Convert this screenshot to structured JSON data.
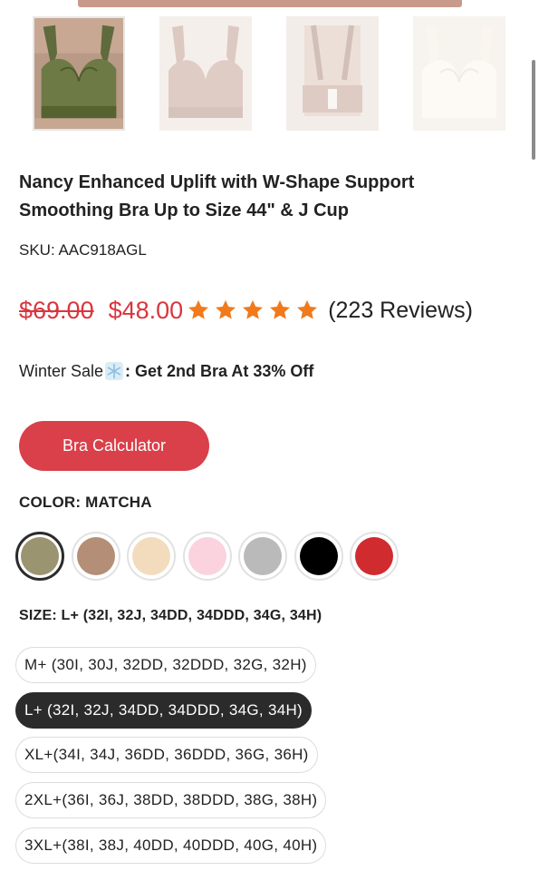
{
  "product": {
    "title_line1": "Nancy Enhanced Uplift with W-Shape Support",
    "title_line2": "Smoothing Bra Up to Size 44\" & J Cup",
    "sku": "SKU: AAC918AGL",
    "old_price": "$69.00",
    "new_price": "$48.00",
    "rating": 5,
    "reviews": "(223 Reviews)"
  },
  "promo": {
    "label": "Winter Sale",
    "icon": "snowflake-icon",
    "offer": ": Get 2nd Bra At 33% Off"
  },
  "calculator_button": "Bra Calculator",
  "color": {
    "label": "COLOR: MATCHA",
    "options": [
      {
        "name": "matcha",
        "hex": "#9a9470",
        "selected": true
      },
      {
        "name": "mocha",
        "hex": "#b48e77",
        "selected": false
      },
      {
        "name": "beige",
        "hex": "#f3dcbd",
        "selected": false
      },
      {
        "name": "pink",
        "hex": "#fad3df",
        "selected": false
      },
      {
        "name": "grey",
        "hex": "#bababa",
        "selected": false
      },
      {
        "name": "black",
        "hex": "#000000",
        "selected": false
      },
      {
        "name": "red",
        "hex": "#d02b2f",
        "selected": false
      }
    ]
  },
  "size": {
    "label": "SIZE: L+ (32I,  32J,  34DD,  34DDD,  34G,  34H)",
    "options": [
      {
        "label": "M+ (30I,  30J,  32DD,  32DDD,  32G,  32H)",
        "selected": false
      },
      {
        "label": "L+ (32I,  32J,  34DD,  34DDD,  34G,  34H)",
        "selected": true
      },
      {
        "label": "XL+(34I,  34J,  36DD,  36DDD,  36G,  36H)",
        "selected": false
      },
      {
        "label": "2XL+(36I,  36J,  38DD,  38DDD,  38G,  38H)",
        "selected": false
      },
      {
        "label": "3XL+(38I,  38J,  40DD,  40DDD,  40G,  40H)",
        "selected": false
      }
    ]
  },
  "colors": {
    "accent_red": "#d9363e",
    "button_red": "#d9404a",
    "star_orange": "#f07a1c",
    "selected_dark": "#2b2b2b"
  }
}
